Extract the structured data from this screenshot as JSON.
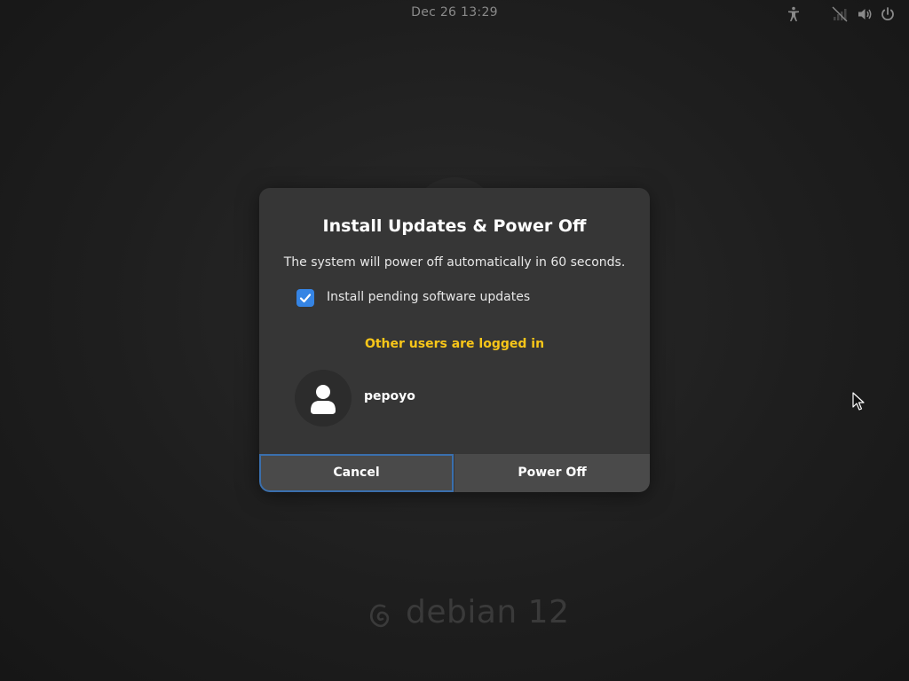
{
  "topbar": {
    "datetime": "Dec 26  13:29",
    "tray_icons": [
      "accessibility-icon",
      "network-icon",
      "volume-icon",
      "power-icon"
    ]
  },
  "dialog": {
    "title": "Install Updates & Power Off",
    "message": "The system will power off automatically in 60 seconds.",
    "checkbox": {
      "label": "Install pending software updates",
      "checked": true
    },
    "warning": "Other users are logged in",
    "users": [
      {
        "name": "pepoyo",
        "avatar_icon": "user-icon"
      }
    ],
    "buttons": {
      "cancel_label": "Cancel",
      "poweroff_label": "Power Off"
    }
  },
  "branding": {
    "logo_icon": "debian-swirl-icon",
    "text": "debian 12"
  },
  "colors": {
    "accent": "#3584e4",
    "warning": "#f8c619",
    "dialog_bg": "#363636",
    "button_bg": "#4a4a4a",
    "desktop_bg": "#1e1e1e"
  }
}
